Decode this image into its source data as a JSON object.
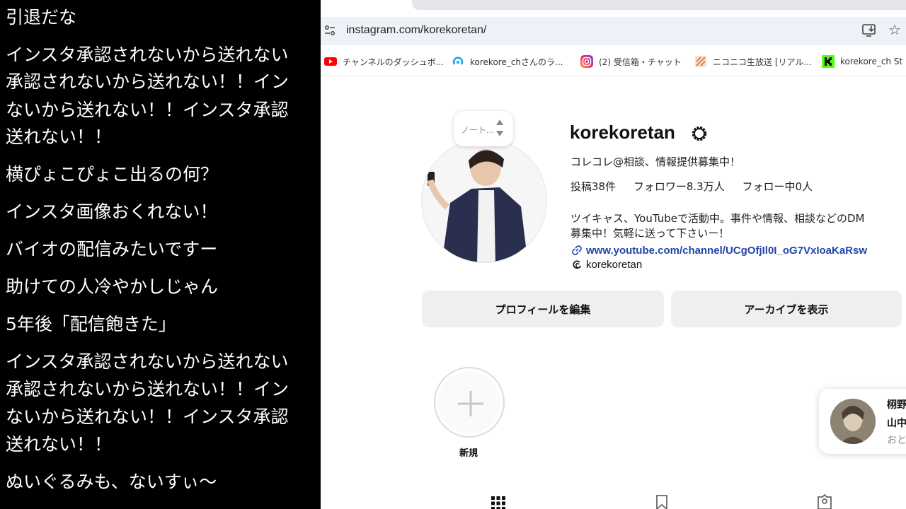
{
  "comments": [
    "引退だな",
    "インスタ承認されないから送れない",
    "承認されないから送れない！！イン",
    "ないから送れない！！インスタ承認",
    "送れない！！",
    "横ぴょこぴょこ出るの何？",
    "インスタ画像おくれない！",
    "バイオの配信みたいですー",
    "助けての人冷やかしじゃん",
    "5年後「配信飽きた」",
    "インスタ承認されないから送れない",
    "承認されないから送れない！！イン",
    "ないから送れない！！インスタ承認",
    "送れない！！",
    "ぬいぐるみも、ないすぃ～"
  ],
  "browser": {
    "url": "instagram.com/korekoretan/",
    "bookmarks": [
      {
        "label": "チャンネルのダッシュボ...",
        "icon": "youtube-icon"
      },
      {
        "label": "korekore_chさんのラ...",
        "icon": "live-icon"
      },
      {
        "label": "(2) 受信箱・チャット",
        "icon": "instagram-icon"
      },
      {
        "label": "ニコニコ生放送 [リアル...",
        "icon": "niconico-icon"
      },
      {
        "label": "korekore_ch St",
        "icon": "kick-icon"
      }
    ]
  },
  "profile": {
    "note": "ノート...",
    "username": "korekoretan",
    "display_name": "コレコレ@相談、情報提供募集中！",
    "posts": "投稿38件",
    "followers": "フォロワー8.3万人",
    "following": "フォロー中0人",
    "bio_line1": "ツイキャス、YouTubeで活動中。事件や情報、相談などのDM",
    "bio_line2": "募集中！気軽に送って下さいー！",
    "link": "www.youtube.com/channel/UCgOfjIl0I_oG7VxIoaKaRsw",
    "threads": "korekoretan",
    "edit_button": "プロフィールを編集",
    "archive_button": "アーカイブを表示",
    "new_highlight": "新規"
  },
  "notification": {
    "line1": "栩野",
    "line2": "山中",
    "line3": "おと"
  },
  "colors": {
    "comment_bg": "#000000",
    "comment_text": "#ffffff",
    "link": "#2244aa",
    "button_bg": "#efefef"
  }
}
